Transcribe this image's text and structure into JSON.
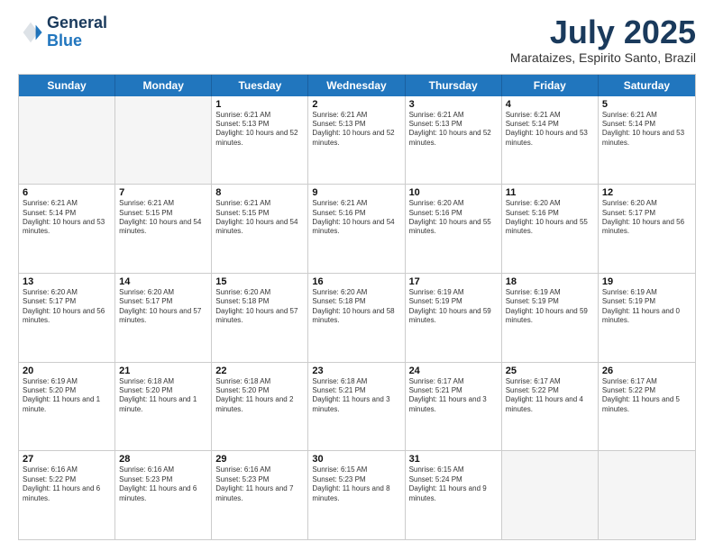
{
  "header": {
    "logo_general": "General",
    "logo_blue": "Blue",
    "month_title": "July 2025",
    "location": "Marataizes, Espirito Santo, Brazil"
  },
  "days_of_week": [
    "Sunday",
    "Monday",
    "Tuesday",
    "Wednesday",
    "Thursday",
    "Friday",
    "Saturday"
  ],
  "weeks": [
    [
      {
        "day": "",
        "text": ""
      },
      {
        "day": "",
        "text": ""
      },
      {
        "day": "1",
        "text": "Sunrise: 6:21 AM\nSunset: 5:13 PM\nDaylight: 10 hours and 52 minutes."
      },
      {
        "day": "2",
        "text": "Sunrise: 6:21 AM\nSunset: 5:13 PM\nDaylight: 10 hours and 52 minutes."
      },
      {
        "day": "3",
        "text": "Sunrise: 6:21 AM\nSunset: 5:13 PM\nDaylight: 10 hours and 52 minutes."
      },
      {
        "day": "4",
        "text": "Sunrise: 6:21 AM\nSunset: 5:14 PM\nDaylight: 10 hours and 53 minutes."
      },
      {
        "day": "5",
        "text": "Sunrise: 6:21 AM\nSunset: 5:14 PM\nDaylight: 10 hours and 53 minutes."
      }
    ],
    [
      {
        "day": "6",
        "text": "Sunrise: 6:21 AM\nSunset: 5:14 PM\nDaylight: 10 hours and 53 minutes."
      },
      {
        "day": "7",
        "text": "Sunrise: 6:21 AM\nSunset: 5:15 PM\nDaylight: 10 hours and 54 minutes."
      },
      {
        "day": "8",
        "text": "Sunrise: 6:21 AM\nSunset: 5:15 PM\nDaylight: 10 hours and 54 minutes."
      },
      {
        "day": "9",
        "text": "Sunrise: 6:21 AM\nSunset: 5:16 PM\nDaylight: 10 hours and 54 minutes."
      },
      {
        "day": "10",
        "text": "Sunrise: 6:20 AM\nSunset: 5:16 PM\nDaylight: 10 hours and 55 minutes."
      },
      {
        "day": "11",
        "text": "Sunrise: 6:20 AM\nSunset: 5:16 PM\nDaylight: 10 hours and 55 minutes."
      },
      {
        "day": "12",
        "text": "Sunrise: 6:20 AM\nSunset: 5:17 PM\nDaylight: 10 hours and 56 minutes."
      }
    ],
    [
      {
        "day": "13",
        "text": "Sunrise: 6:20 AM\nSunset: 5:17 PM\nDaylight: 10 hours and 56 minutes."
      },
      {
        "day": "14",
        "text": "Sunrise: 6:20 AM\nSunset: 5:17 PM\nDaylight: 10 hours and 57 minutes."
      },
      {
        "day": "15",
        "text": "Sunrise: 6:20 AM\nSunset: 5:18 PM\nDaylight: 10 hours and 57 minutes."
      },
      {
        "day": "16",
        "text": "Sunrise: 6:20 AM\nSunset: 5:18 PM\nDaylight: 10 hours and 58 minutes."
      },
      {
        "day": "17",
        "text": "Sunrise: 6:19 AM\nSunset: 5:19 PM\nDaylight: 10 hours and 59 minutes."
      },
      {
        "day": "18",
        "text": "Sunrise: 6:19 AM\nSunset: 5:19 PM\nDaylight: 10 hours and 59 minutes."
      },
      {
        "day": "19",
        "text": "Sunrise: 6:19 AM\nSunset: 5:19 PM\nDaylight: 11 hours and 0 minutes."
      }
    ],
    [
      {
        "day": "20",
        "text": "Sunrise: 6:19 AM\nSunset: 5:20 PM\nDaylight: 11 hours and 1 minute."
      },
      {
        "day": "21",
        "text": "Sunrise: 6:18 AM\nSunset: 5:20 PM\nDaylight: 11 hours and 1 minute."
      },
      {
        "day": "22",
        "text": "Sunrise: 6:18 AM\nSunset: 5:20 PM\nDaylight: 11 hours and 2 minutes."
      },
      {
        "day": "23",
        "text": "Sunrise: 6:18 AM\nSunset: 5:21 PM\nDaylight: 11 hours and 3 minutes."
      },
      {
        "day": "24",
        "text": "Sunrise: 6:17 AM\nSunset: 5:21 PM\nDaylight: 11 hours and 3 minutes."
      },
      {
        "day": "25",
        "text": "Sunrise: 6:17 AM\nSunset: 5:22 PM\nDaylight: 11 hours and 4 minutes."
      },
      {
        "day": "26",
        "text": "Sunrise: 6:17 AM\nSunset: 5:22 PM\nDaylight: 11 hours and 5 minutes."
      }
    ],
    [
      {
        "day": "27",
        "text": "Sunrise: 6:16 AM\nSunset: 5:22 PM\nDaylight: 11 hours and 6 minutes."
      },
      {
        "day": "28",
        "text": "Sunrise: 6:16 AM\nSunset: 5:23 PM\nDaylight: 11 hours and 6 minutes."
      },
      {
        "day": "29",
        "text": "Sunrise: 6:16 AM\nSunset: 5:23 PM\nDaylight: 11 hours and 7 minutes."
      },
      {
        "day": "30",
        "text": "Sunrise: 6:15 AM\nSunset: 5:23 PM\nDaylight: 11 hours and 8 minutes."
      },
      {
        "day": "31",
        "text": "Sunrise: 6:15 AM\nSunset: 5:24 PM\nDaylight: 11 hours and 9 minutes."
      },
      {
        "day": "",
        "text": ""
      },
      {
        "day": "",
        "text": ""
      }
    ]
  ]
}
